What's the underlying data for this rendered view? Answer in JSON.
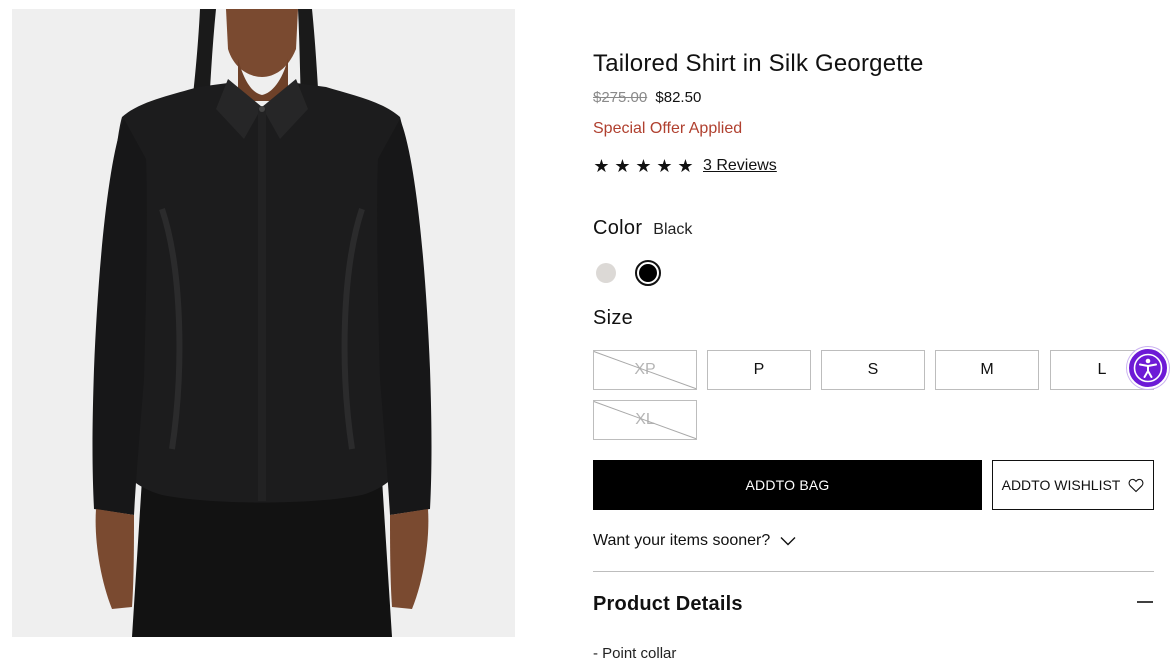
{
  "product": {
    "title": "Tailored Shirt in Silk Georgette",
    "original_price": "$275.00",
    "sale_price": "$82.50",
    "offer_text": "Special Offer Applied",
    "rating": 5,
    "star_glyph": "★",
    "reviews_label": "3 Reviews"
  },
  "color": {
    "label": "Color",
    "selected_value": "Black",
    "swatches": [
      {
        "name": "Light Grey",
        "hex": "#dcd9d6",
        "selected": false
      },
      {
        "name": "Black",
        "hex": "#000000",
        "selected": true
      }
    ]
  },
  "size": {
    "label": "Size",
    "options": [
      {
        "label": "XP",
        "available": false
      },
      {
        "label": "P",
        "available": true
      },
      {
        "label": "S",
        "available": true
      },
      {
        "label": "M",
        "available": true
      },
      {
        "label": "L",
        "available": true
      },
      {
        "label": "XL",
        "available": false
      }
    ]
  },
  "actions": {
    "add_to_bag": "ADDTO BAG",
    "add_to_wishlist": "ADDTO WISHLIST",
    "wishlist_icon": "heart-icon"
  },
  "delivery": {
    "label": "Want your items sooner?",
    "icon": "chevron-down-icon"
  },
  "details": {
    "heading": "Product Details",
    "toggle_icon": "minus-icon",
    "items": [
      "- Point collar"
    ]
  },
  "accessibility": {
    "icon": "accessibility-icon",
    "color": "#6d1ad6"
  }
}
